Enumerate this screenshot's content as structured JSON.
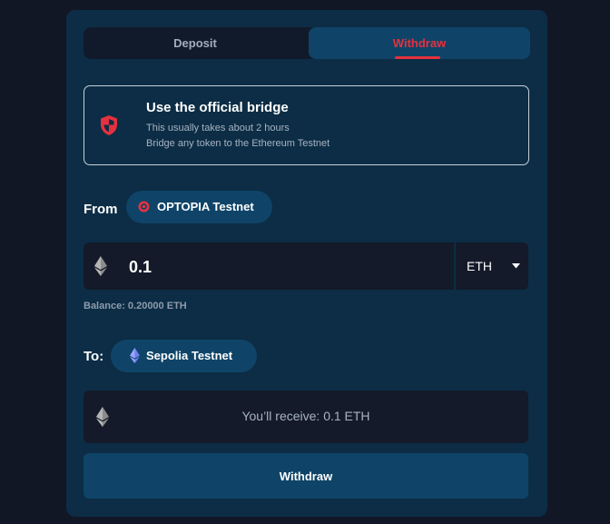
{
  "tabs": {
    "deposit_label": "Deposit",
    "withdraw_label": "Withdraw",
    "active": "Withdraw"
  },
  "bridge": {
    "title": "Use the official bridge",
    "line1": "This usually takes about 2 hours",
    "line2": "Bridge any token to the Ethereum Testnet"
  },
  "from": {
    "label": "From",
    "network": "OPTOPIA Testnet",
    "network_icon": "optopia-logo-icon"
  },
  "amount": {
    "value": "0.1",
    "token": "ETH",
    "balance": "Balance: 0.20000 ETH"
  },
  "to": {
    "label": "To:",
    "network": "Sepolia Testnet",
    "network_icon": "ethereum-logo-icon"
  },
  "receive": {
    "text": "You’ll receive: 0.1 ETH"
  },
  "action": {
    "withdraw_label": "Withdraw"
  },
  "colors": {
    "background": "#121726",
    "card": "#0c2d45",
    "accent_red": "#e5313f",
    "active_blue": "#0f4468",
    "input_dark": "#141a29"
  }
}
